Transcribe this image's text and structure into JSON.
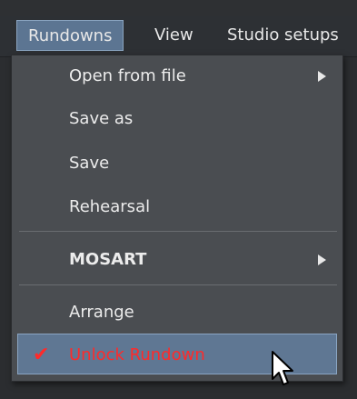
{
  "menubar": {
    "items": [
      {
        "label": "Rundowns",
        "active": true
      },
      {
        "label": "View",
        "active": false
      },
      {
        "label": "Studio setups",
        "active": false
      }
    ]
  },
  "menu": {
    "items": [
      {
        "label": "Open from file",
        "has_submenu": true
      },
      {
        "label": "Save as"
      },
      {
        "label": "Save"
      },
      {
        "label": "Rehearsal"
      },
      {
        "label": "MOSART",
        "has_submenu": true,
        "bold": true
      },
      {
        "label": "Arrange"
      },
      {
        "label": "Unlock Rundown",
        "checked": true,
        "highlighted": true
      }
    ]
  },
  "icons": {
    "submenu": "chevron-right-icon",
    "check": "checkmark-icon",
    "cursor": "mouse-cursor-icon"
  },
  "colors": {
    "menubar_bg": "#2d3034",
    "menu_bg": "#4a4d51",
    "highlight_bg": "#5f7793",
    "highlight_text": "#ff2a2a",
    "text": "#ececec"
  }
}
